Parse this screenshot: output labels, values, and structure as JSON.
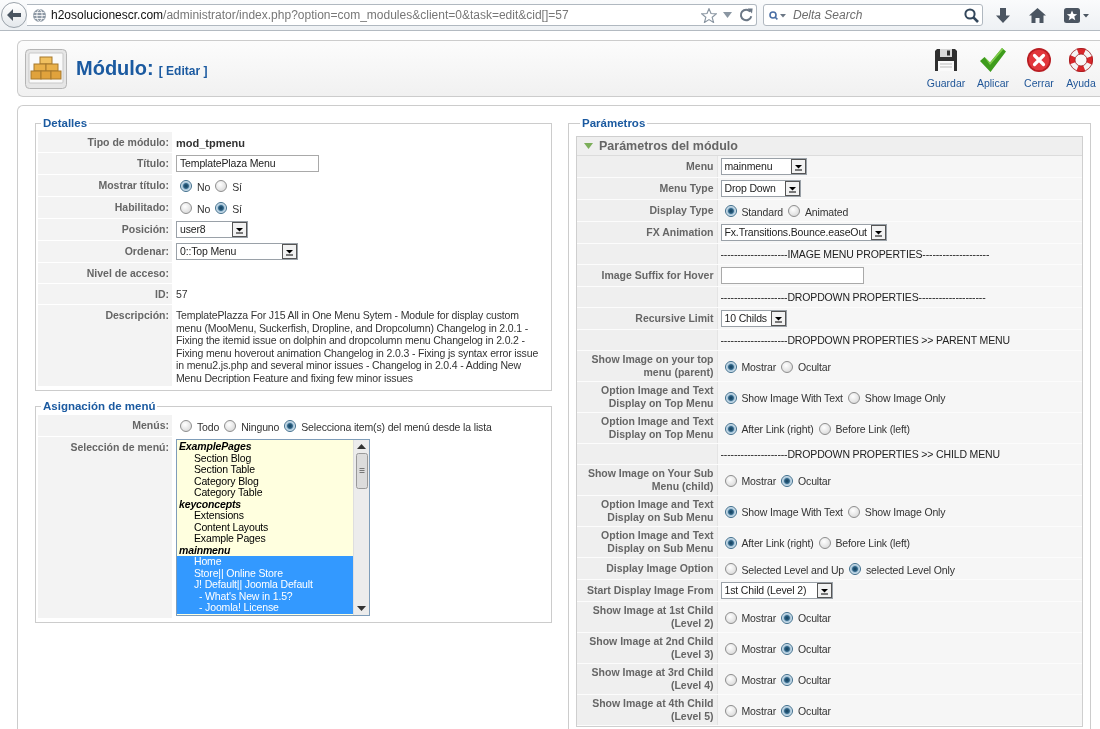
{
  "browser": {
    "url": {
      "host": "h2osolucionescr.com",
      "path": "/administrator/index.php?option=com_modules&client=0&task=edit&cid[]=57"
    },
    "search": {
      "placeholder": "Delta Search"
    }
  },
  "header": {
    "title": "Módulo:",
    "subtitle": "[ Editar ]",
    "toolbar": [
      {
        "kind": "save",
        "label": "Guardar"
      },
      {
        "kind": "apply",
        "label": "Aplicar"
      },
      {
        "kind": "close",
        "label": "Cerrar"
      },
      {
        "kind": "help",
        "label": "Ayuda"
      }
    ]
  },
  "details": {
    "legend": "Detalles",
    "rows": [
      {
        "kind": "strong",
        "label": "Tipo de módulo:",
        "value": "mod_tpmenu"
      },
      {
        "kind": "input",
        "label": "Título:",
        "value": "TemplatePlaza Menu"
      },
      {
        "kind": "radio",
        "label": "Mostrar título:",
        "options": [
          {
            "label": "No",
            "selected": true
          },
          {
            "label": "Sí",
            "selected": false
          }
        ]
      },
      {
        "kind": "radio",
        "label": "Habilitado:",
        "options": [
          {
            "label": "No",
            "selected": false
          },
          {
            "label": "Sí",
            "selected": true
          }
        ]
      },
      {
        "kind": "select",
        "label": "Posición:",
        "value": "user8"
      },
      {
        "kind": "select",
        "label": "Ordenar:",
        "value": "0::Top Menu"
      },
      {
        "kind": "empty",
        "label": "Nivel de acceso:"
      },
      {
        "kind": "text",
        "label": "ID:",
        "value": "57"
      },
      {
        "kind": "text",
        "label": "Descripción:",
        "value": "TemplatePlazza For J15 All in One Menu Sytem - Module for display custom menu (MooMenu, Suckerfish, Dropline, and Dropcolumn) Changelog in 2.0.1 - Fixing the itemid issue on dolphin and dropcolumn menu Changelog in 2.0.2 - Fixing menu hoverout animation Changelog in 2.0.3 - Fixing js syntax error issue in menu2.js.php and several minor issues - Changelog in 2.0.4 - Adding New Menu Decription Feature and fixing few minor issues"
      }
    ]
  },
  "menu_assignment": {
    "legend": "Asignación de menú",
    "rows": [
      {
        "kind": "radio",
        "label": "Menús:",
        "options": [
          {
            "label": "Todo",
            "selected": false
          },
          {
            "label": "Ninguno",
            "selected": false
          },
          {
            "label": "Selecciona item(s) del menú desde la lista",
            "selected": true
          }
        ]
      },
      {
        "kind": "listbox",
        "label": "Selección de menú:",
        "groups": [
          {
            "label": "ExamplePages",
            "children": [
              {
                "label": "Section Blog",
                "selected": false
              },
              {
                "label": "Section Table",
                "selected": false
              },
              {
                "label": "Category Blog",
                "selected": false
              },
              {
                "label": "Category Table",
                "selected": false
              }
            ]
          },
          {
            "label": "keyconcepts",
            "children": [
              {
                "label": "Extensions",
                "selected": false
              },
              {
                "label": "Content Layouts",
                "selected": false
              },
              {
                "label": "Example Pages",
                "selected": false
              }
            ]
          },
          {
            "label": "mainmenu",
            "children": [
              {
                "label": "Home",
                "selected": true
              },
              {
                "label": "Store|| Online Store",
                "selected": true
              },
              {
                "label": "J! Default|| Joomla Default",
                "selected": true,
                "children": [
                  {
                    "label": "- What's New in 1.5?",
                    "selected": true
                  },
                  {
                    "label": "- Joomla! License",
                    "selected": true
                  }
                ]
              }
            ]
          }
        ]
      }
    ]
  },
  "parameters": {
    "legend": "Parámetros",
    "panel": {
      "title": "Parámetros del módulo",
      "expanded": true,
      "rows": [
        {
          "kind": "select",
          "label": "Menu",
          "value": "mainmenu"
        },
        {
          "kind": "select",
          "label": "Menu Type",
          "value": "Drop Down"
        },
        {
          "kind": "radio",
          "label": "Display Type",
          "options": [
            {
              "label": "Standard",
              "selected": true
            },
            {
              "label": "Animated",
              "selected": false
            }
          ]
        },
        {
          "kind": "select",
          "label": "FX Animation",
          "value": "Fx.Transitions.Bounce.easeOut"
        },
        {
          "kind": "spacer",
          "value": "--------------------IMAGE MENU PROPERTIES--------------------"
        },
        {
          "kind": "input",
          "label": "Image Suffix for Hover"
        },
        {
          "kind": "spacer",
          "value": "--------------------DROPDOWN PROPERTIES--------------------"
        },
        {
          "kind": "select",
          "label": "Recursive Limit",
          "value": "10 Childs"
        },
        {
          "kind": "spacer",
          "value": "--------------------DROPDOWN PROPERTIES >> PARENT MENU"
        },
        {
          "kind": "radio",
          "label": "Show Image on your top menu (parent)",
          "options": [
            {
              "label": "Mostrar",
              "selected": true
            },
            {
              "label": "Ocultar",
              "selected": false
            }
          ]
        },
        {
          "kind": "radio",
          "label": "Option Image and Text Display on Top Menu",
          "options": [
            {
              "label": "Show Image With Text",
              "selected": true
            },
            {
              "label": "Show Image Only",
              "selected": false
            }
          ]
        },
        {
          "kind": "radio",
          "label": "Option Image and Text Display on Top Menu",
          "options": [
            {
              "label": "After Link (right)",
              "selected": true
            },
            {
              "label": "Before Link (left)",
              "selected": false
            }
          ]
        },
        {
          "kind": "spacer",
          "value": "--------------------DROPDOWN PROPERTIES >> CHILD MENU"
        },
        {
          "kind": "radio",
          "label": "Show Image on Your Sub Menu (child)",
          "options": [
            {
              "label": "Mostrar",
              "selected": false
            },
            {
              "label": "Ocultar",
              "selected": true
            }
          ]
        },
        {
          "kind": "radio",
          "label": "Option Image and Text Display on Sub Menu",
          "options": [
            {
              "label": "Show Image With Text",
              "selected": true
            },
            {
              "label": "Show Image Only",
              "selected": false
            }
          ]
        },
        {
          "kind": "radio",
          "label": "Option Image and Text Display on Sub Menu",
          "options": [
            {
              "label": "After Link (right)",
              "selected": true
            },
            {
              "label": "Before Link (left)",
              "selected": false
            }
          ]
        },
        {
          "kind": "radio",
          "label": "Display Image Option",
          "options": [
            {
              "label": "Selected Level and Up",
              "selected": false
            },
            {
              "label": "selected Level Only",
              "selected": true
            }
          ]
        },
        {
          "kind": "select",
          "label": "Start Display Image From",
          "value": "1st Child (Level 2)"
        },
        {
          "kind": "radio",
          "label": "Show Image at 1st Child (Level 2)",
          "options": [
            {
              "label": "Mostrar",
              "selected": false
            },
            {
              "label": "Ocultar",
              "selected": true
            }
          ]
        },
        {
          "kind": "radio",
          "label": "Show Image at 2nd Child (Level 3)",
          "options": [
            {
              "label": "Mostrar",
              "selected": false
            },
            {
              "label": "Ocultar",
              "selected": true
            }
          ]
        },
        {
          "kind": "radio",
          "label": "Show Image at 3rd Child (Level 4)",
          "options": [
            {
              "label": "Mostrar",
              "selected": false
            },
            {
              "label": "Ocultar",
              "selected": true
            }
          ]
        },
        {
          "kind": "radio",
          "label": "Show Image at 4th Child (Level 5)",
          "options": [
            {
              "label": "Mostrar",
              "selected": false
            },
            {
              "label": "Ocultar",
              "selected": true
            }
          ]
        }
      ]
    }
  }
}
